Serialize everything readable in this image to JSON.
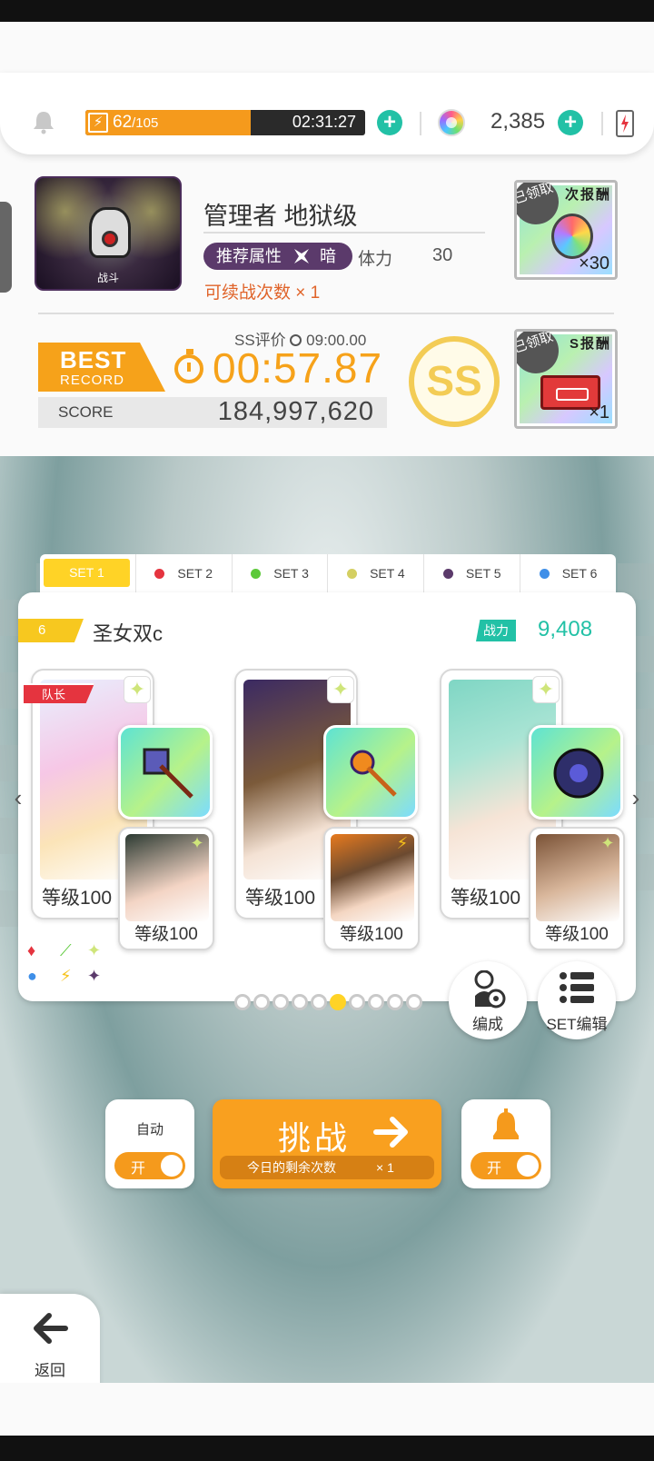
{
  "resources": {
    "stamina_current": "62",
    "stamina_max": "/105",
    "stamina_fill_fraction": 0.59,
    "stamina_timer": "02:31:27",
    "gems": "2,385"
  },
  "stage": {
    "thumb_label": "战斗",
    "title": "管理者 地狱级",
    "recommended_attr_label": "推荐属性",
    "recommended_attr": "暗",
    "stamina_label": "体力",
    "stamina_cost": "30",
    "continue_text": "可续战次数 × 1"
  },
  "rewards": [
    {
      "title": "次报酬",
      "claimed": "已领取",
      "qty": "×30"
    },
    {
      "title": "S报酬",
      "claimed": "已领取",
      "qty": "×1"
    }
  ],
  "record": {
    "ss_condition": "SS评价",
    "ss_time": "09:00.00",
    "best_line1": "BEST",
    "best_line2": "RECORD",
    "best_time": "00:57.87",
    "score_label": "SCORE",
    "score_value": "184,997,620",
    "rank": "SS"
  },
  "set_tabs": [
    {
      "label": "SET 1",
      "color": "#ffd326",
      "active": true
    },
    {
      "label": "SET 2",
      "color": "#e5343f",
      "active": false
    },
    {
      "label": "SET 3",
      "color": "#5cc93a",
      "active": false
    },
    {
      "label": "SET 4",
      "color": "#d4cf62",
      "active": false
    },
    {
      "label": "SET 5",
      "color": "#5b3a6b",
      "active": false
    },
    {
      "label": "SET 6",
      "color": "#3f8fe8",
      "active": false
    }
  ],
  "team": {
    "number": "6",
    "name": "圣女双c",
    "power_label": "战力",
    "power_value": "9,408",
    "leader_label": "队长",
    "units": [
      {
        "level": "等级100",
        "sub_level": "等级100"
      },
      {
        "level": "等级100",
        "sub_level": "等级100"
      },
      {
        "level": "等级100",
        "sub_level": "等级100"
      }
    ]
  },
  "pager": {
    "total": 10,
    "active_index": 5
  },
  "buttons": {
    "formation": "编成",
    "set_edit": "SET编辑",
    "auto_label": "自动",
    "toggle_on": "开",
    "notify_toggle_on": "开",
    "challenge": "挑战",
    "remaining_label": "今日的剩余次数",
    "remaining_value": "× 1",
    "back": "返回"
  },
  "colors": {
    "accent_orange": "#f9a01f",
    "teal": "#22c1a6",
    "gold": "#f3cc55",
    "dark_attr": "#5b3a6b"
  },
  "icons": [
    "bell-icon",
    "lightning-icon",
    "plus-icon",
    "gem-icon",
    "battery-icon",
    "stopwatch-icon",
    "arrow-right-icon",
    "arrow-left-icon",
    "gear-person-icon",
    "list-icon",
    "chevron-left-icon",
    "chevron-right-icon"
  ]
}
